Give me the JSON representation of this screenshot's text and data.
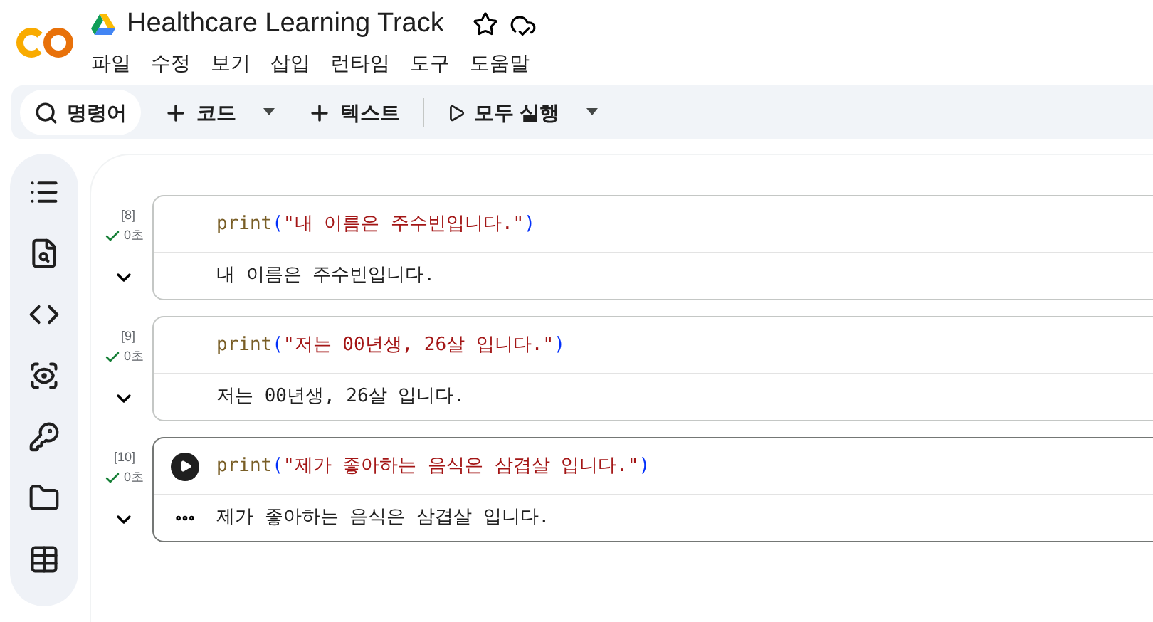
{
  "title": "Healthcare Learning Track",
  "menu": [
    "파일",
    "수정",
    "보기",
    "삽입",
    "런타임",
    "도구",
    "도움말"
  ],
  "toolbar": [
    {
      "kind": "search",
      "label": "명령어"
    },
    {
      "kind": "add",
      "label": "코드",
      "dropdown": true
    },
    {
      "kind": "add",
      "label": "텍스트",
      "dropdown": false
    },
    {
      "kind": "run",
      "label": "모두 실행",
      "dropdown": true
    }
  ],
  "cells": [
    {
      "count": "[8]",
      "time": "0초",
      "selected": false,
      "code": [
        {
          "kind": "function",
          "text": "print"
        },
        {
          "kind": "punct",
          "text": "("
        },
        {
          "kind": "string",
          "text": "\"내 이름은 주수빈입니다.\""
        },
        {
          "kind": "punct",
          "text": ")"
        }
      ],
      "output": "내 이름은 주수빈입니다."
    },
    {
      "count": "[9]",
      "time": "0초",
      "selected": false,
      "code": [
        {
          "kind": "function",
          "text": "print"
        },
        {
          "kind": "punct",
          "text": "("
        },
        {
          "kind": "string",
          "text": "\"저는 00년생, 26살 입니다.\""
        },
        {
          "kind": "punct",
          "text": ")"
        }
      ],
      "output": "저는 00년생, 26살 입니다."
    },
    {
      "count": "[10]",
      "time": "0초",
      "selected": true,
      "code": [
        {
          "kind": "function",
          "text": "print"
        },
        {
          "kind": "punct",
          "text": "("
        },
        {
          "kind": "string",
          "text": "\"제가 좋아하는 음식은 삼겹살 입니다.\""
        },
        {
          "kind": "punct",
          "text": ")"
        }
      ],
      "output": "제가 좋아하는 음식은 삼겹살 입니다."
    }
  ]
}
